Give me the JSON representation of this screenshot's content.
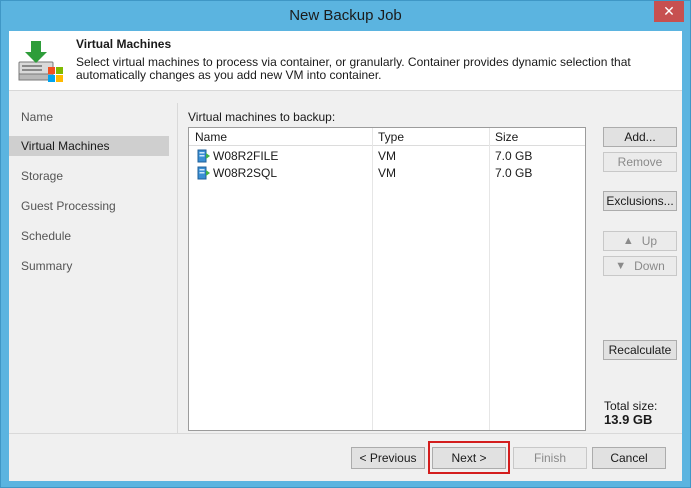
{
  "window": {
    "title": "New Backup Job",
    "close_glyph": "✕"
  },
  "header": {
    "title": "Virtual Machines",
    "description": "Select virtual machines to process via container, or granularly. Container provides dynamic selection that automatically changes as you add new VM into container.",
    "icon": "download-server-icon"
  },
  "nav": {
    "items": [
      {
        "label": "Name",
        "active": false
      },
      {
        "label": "Virtual Machines",
        "active": true
      },
      {
        "label": "Storage",
        "active": false
      },
      {
        "label": "Guest Processing",
        "active": false
      },
      {
        "label": "Schedule",
        "active": false
      },
      {
        "label": "Summary",
        "active": false
      }
    ]
  },
  "vm_table": {
    "label": "Virtual machines to backup:",
    "columns": [
      "Name",
      "Type",
      "Size"
    ],
    "rows": [
      {
        "name": "W08R2FILE",
        "type": "VM",
        "size": "7.0 GB"
      },
      {
        "name": "W08R2SQL",
        "type": "VM",
        "size": "7.0 GB"
      }
    ]
  },
  "side_buttons": {
    "add": "Add...",
    "remove": "Remove",
    "exclusions": "Exclusions...",
    "up": "Up",
    "down": "Down",
    "recalculate": "Recalculate"
  },
  "total": {
    "label": "Total size:",
    "value": "13.9 GB"
  },
  "footer": {
    "previous": "< Previous",
    "next": "Next >",
    "finish": "Finish",
    "cancel": "Cancel"
  },
  "colors": {
    "frame": "#5bb4e0",
    "highlight": "#d31d1d",
    "close_button": "#c75050"
  }
}
